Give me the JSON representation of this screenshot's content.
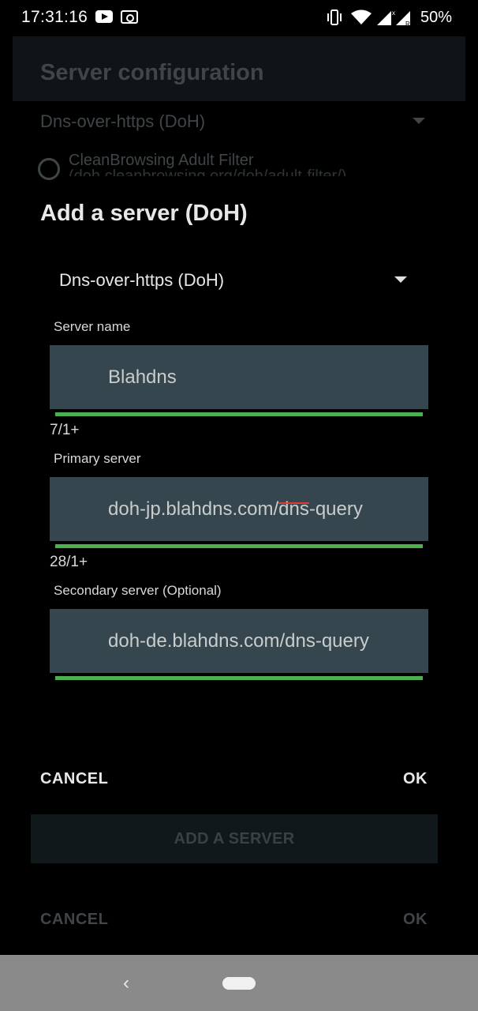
{
  "status_bar": {
    "time": "17:31:16",
    "battery": "50%"
  },
  "background_dialog": {
    "title": "Server configuration",
    "select_value": "Dns-over-https (DoH)",
    "radio_label": "CleanBrowsing Adult Filter",
    "radio_sublabel": "(doh.cleanbrowsing.org/doh/adult-filter/)",
    "cancel_label": "CANCEL",
    "ok_label": "OK",
    "add_server_label": "ADD A SERVER"
  },
  "dialog": {
    "title": "Add a server (DoH)",
    "protocol_select": "Dns-over-https (DoH)",
    "fields": [
      {
        "label": "Server name",
        "value": "Blahdns",
        "counter": "7/1+"
      },
      {
        "label": "Primary server",
        "value_before": "doh-jp.blahdns.com/",
        "value_misspelled": "dns",
        "value_after": "-query",
        "counter": "28/1+"
      },
      {
        "label": "Secondary server (Optional)",
        "value": "doh-de.blahdns.com/dns-query"
      }
    ],
    "cancel_label": "CANCEL",
    "ok_label": "OK"
  },
  "colors": {
    "accent_green": "#4caf50",
    "field_bg": "#36464e",
    "spellcheck_red": "#e53935"
  }
}
